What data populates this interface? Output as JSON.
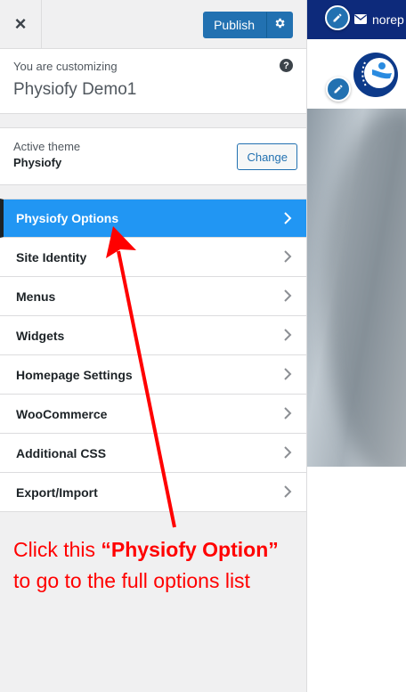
{
  "header": {
    "close_symbol": "×",
    "publish_label": "Publish",
    "settings_icon": "gear-icon"
  },
  "customizing": {
    "label": "You are customizing",
    "site_name": "Physiofy Demo1",
    "help_symbol": "?"
  },
  "theme": {
    "label": "Active theme",
    "name": "Physiofy",
    "change_label": "Change"
  },
  "menu": {
    "items": [
      {
        "label": "Physiofy Options"
      },
      {
        "label": "Site Identity"
      },
      {
        "label": "Menus"
      },
      {
        "label": "Widgets"
      },
      {
        "label": "Homepage Settings"
      },
      {
        "label": "WooCommerce"
      },
      {
        "label": "Additional CSS"
      },
      {
        "label": "Export/Import"
      }
    ]
  },
  "annotation": {
    "line1_prefix": "Click this ",
    "line1_bold": "“Physiofy Option”",
    "line2": "to go to the full options list"
  },
  "preview": {
    "email_text": "norep"
  },
  "colors": {
    "accent": "#2196f3",
    "button": "#2271b1",
    "annotation": "#ff0000",
    "preview_topbar": "#0d2a7b"
  }
}
